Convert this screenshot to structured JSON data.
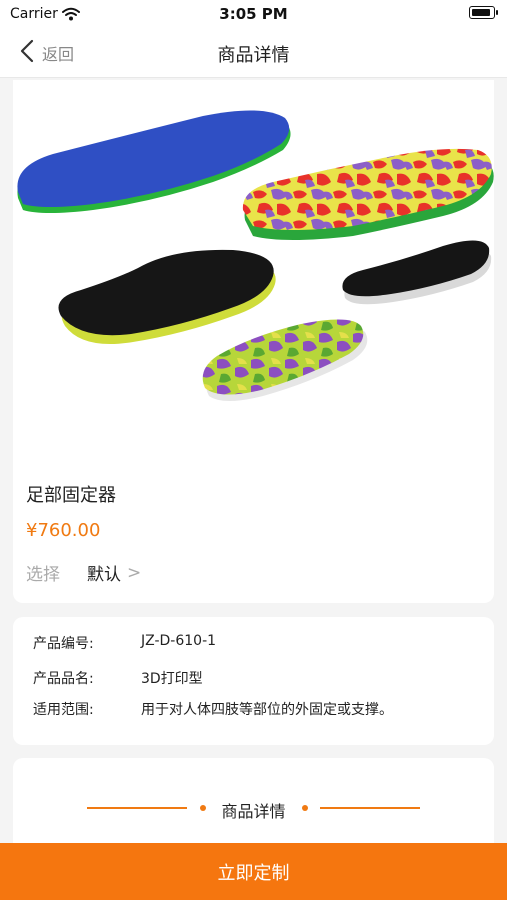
{
  "status_bar": {
    "carrier": "Carrier",
    "time": "3:05 PM"
  },
  "nav": {
    "back_label": "返回",
    "title": "商品详情"
  },
  "product": {
    "name": "足部固定器",
    "price": "¥760.00",
    "spec_label": "选择",
    "spec_value": "默认",
    "spec_chevron": ">"
  },
  "info": [
    {
      "key": "产品编号:",
      "value": "JZ-D-610-1"
    },
    {
      "key": "产品品名:",
      "value": "3D打印型"
    },
    {
      "key": "适用范围:",
      "value": "用于对人体四肢等部位的外固定或支撑。"
    }
  ],
  "detail_section": {
    "title": "商品详情"
  },
  "cta": {
    "label": "立即定制"
  },
  "colors": {
    "accent": "#f5760f",
    "price": "#f07a12",
    "background": "#f4f4f4"
  },
  "icons": [
    "wifi-icon",
    "battery-icon",
    "chevron-left-icon"
  ]
}
